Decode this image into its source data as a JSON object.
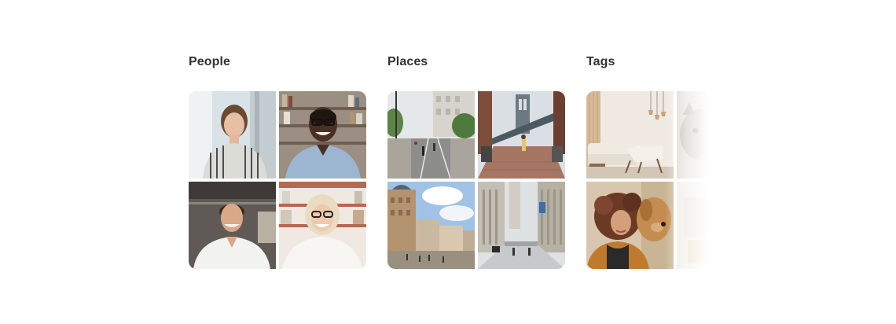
{
  "sections": {
    "people": {
      "title": "People",
      "tiles": [
        {
          "alt": "woman-striped-shirt-photo"
        },
        {
          "alt": "man-glasses-bookshelf-photo"
        },
        {
          "alt": "man-white-shirt-office-photo"
        },
        {
          "alt": "woman-glasses-bookshelf-photo"
        }
      ]
    },
    "places": {
      "title": "Places",
      "tiles": [
        {
          "alt": "city-street-cyclists-photo"
        },
        {
          "alt": "brooklyn-bridge-street-photo"
        },
        {
          "alt": "european-plaza-photo"
        },
        {
          "alt": "downtown-avenue-photo"
        }
      ]
    },
    "tags": {
      "title": "Tags",
      "tiles": [
        {
          "alt": "living-room-interior-photo"
        },
        {
          "alt": "cat-photo"
        },
        {
          "alt": "woman-with-dog-photo"
        },
        {
          "alt": "faded-photo"
        }
      ]
    }
  },
  "colors": {
    "title": "#2e333b",
    "background": "#ffffff"
  }
}
